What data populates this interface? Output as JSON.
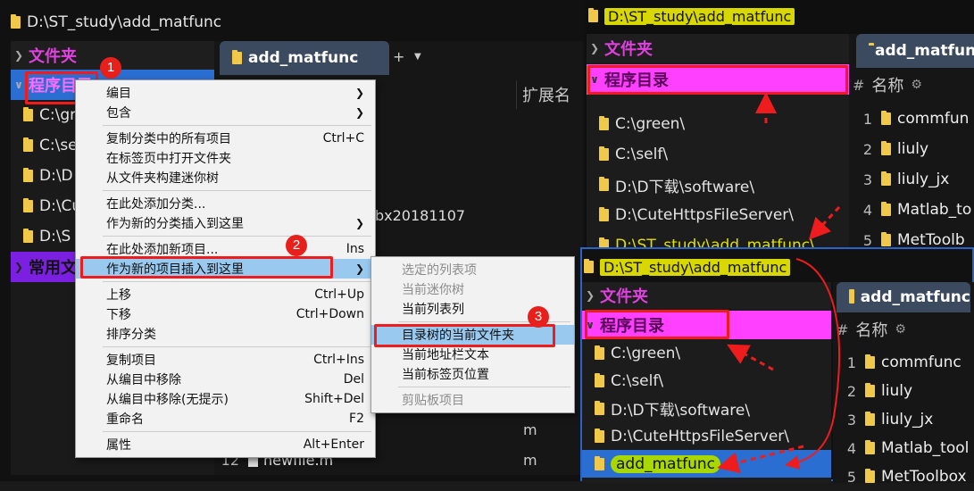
{
  "left": {
    "title": "D:\\ST_study\\add_matfunc",
    "cat_files": "文件夹",
    "cat_prog": "程序目录",
    "cat_common": "常用文",
    "tree": [
      "C:\\gr",
      "C:\\se",
      "D:\\D",
      "D:\\Cu",
      "D:\\S"
    ],
    "tab": "add_matfunc",
    "col_ext": "扩展名",
    "peek_text": "bx20181107",
    "ext_m1": "m",
    "ext_m2": "m",
    "row12_num": "12",
    "row12_name": "newfile.m"
  },
  "context_menu": {
    "items": [
      {
        "label": "编目",
        "shortcut": "",
        "arrow": true
      },
      {
        "label": "包含",
        "shortcut": "",
        "arrow": true
      },
      {
        "sep": true
      },
      {
        "label": "复制分类中的所有项目",
        "shortcut": "Ctrl+C"
      },
      {
        "label": "在标签页中打开文件夹",
        "shortcut": ""
      },
      {
        "label": "从文件夹构建迷你树",
        "shortcut": ""
      },
      {
        "sep": true
      },
      {
        "label": "在此处添加分类...",
        "shortcut": ""
      },
      {
        "label": "作为新的分类插入到这里",
        "shortcut": "",
        "arrow": true
      },
      {
        "sep": true
      },
      {
        "label": "在此处添加新项目...",
        "shortcut": "Ins"
      },
      {
        "label": "作为新的项目插入到这里",
        "shortcut": "",
        "arrow": true,
        "highlight": true
      },
      {
        "sep": true
      },
      {
        "label": "上移",
        "shortcut": "Ctrl+Up"
      },
      {
        "label": "下移",
        "shortcut": "Ctrl+Down"
      },
      {
        "label": "排序分类",
        "shortcut": ""
      },
      {
        "sep": true
      },
      {
        "label": "复制项目",
        "shortcut": "Ctrl+Ins"
      },
      {
        "label": "从编目中移除",
        "shortcut": "Del"
      },
      {
        "label": "从编目中移除(无提示)",
        "shortcut": "Shift+Del"
      },
      {
        "label": "重命名",
        "shortcut": "F2"
      },
      {
        "sep": true
      },
      {
        "label": "属性",
        "shortcut": "Alt+Enter"
      }
    ]
  },
  "submenu": {
    "items": [
      {
        "label": "选定的列表项",
        "disabled": true
      },
      {
        "label": "当前迷你树",
        "disabled": true
      },
      {
        "label": "当前列表列",
        "disabled": false
      },
      {
        "sep": true
      },
      {
        "label": "目录树的当前文件夹",
        "disabled": false,
        "highlight": true
      },
      {
        "label": "当前地址栏文本",
        "disabled": false
      },
      {
        "label": "当前标签页位置",
        "disabled": false
      },
      {
        "sep": true
      },
      {
        "label": "剪贴板项目",
        "disabled": true
      }
    ]
  },
  "badges": [
    "1",
    "2",
    "3"
  ],
  "right_top": {
    "title": "D:\\ST_study\\add_matfunc",
    "cat_files": "文件夹",
    "cat_prog": "程序目录",
    "tree": [
      "C:\\green\\",
      "C:\\self\\",
      "D:\\D下载\\software\\",
      "D:\\CuteHttpsFileServer\\",
      "D:\\ST_study\\add_matfunc\\"
    ],
    "tab": "add_matfunc",
    "col_name": "名称",
    "rows": [
      {
        "num": "1",
        "name": "commfun"
      },
      {
        "num": "2",
        "name": "liuly"
      },
      {
        "num": "3",
        "name": "liuly_jx"
      },
      {
        "num": "4",
        "name": "Matlab_to"
      },
      {
        "num": "5",
        "name": "MetToolb"
      }
    ]
  },
  "right_bottom": {
    "title": "D:\\ST_study\\add_matfunc",
    "cat_files": "文件夹",
    "cat_prog": "程序目录",
    "tree": [
      "C:\\green\\",
      "C:\\self\\",
      "D:\\D下载\\software\\",
      "D:\\CuteHttpsFileServer\\",
      "add_matfunc"
    ],
    "tab": "add_matfunc",
    "col_name": "名称",
    "rows": [
      {
        "num": "1",
        "name": "commfunc"
      },
      {
        "num": "2",
        "name": "liuly"
      },
      {
        "num": "3",
        "name": "liuly_jx"
      },
      {
        "num": "4",
        "name": "Matlab_tool"
      },
      {
        "num": "5",
        "name": "MetToolbox"
      }
    ]
  },
  "colors": {
    "accent_red": "#ee1c1c",
    "category_magenta": "#ff40ff",
    "category_purple": "#7b1fe0",
    "menu_highlight": "#99c9ef",
    "new_item_green": "#a8d800"
  }
}
